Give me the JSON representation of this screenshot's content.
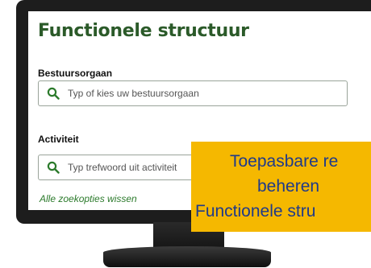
{
  "page": {
    "title": "Functionele structuur"
  },
  "bestuursorgaan": {
    "label": "Bestuursorgaan",
    "placeholder": "Typ of kies uw bestuursorgaan"
  },
  "activiteit": {
    "label": "Activiteit",
    "placeholder": "Typ trefwoord uit activiteit"
  },
  "clear_link": "Alle zoekopties wissen",
  "callout": {
    "lines": [
      "Toepasbare re",
      "beheren",
      "Functionele stru"
    ]
  },
  "colors": {
    "title_green": "#2b5a29",
    "icon_green": "#2b7a2b",
    "callout_bg": "#f5b800",
    "callout_text": "#1f3a8a"
  },
  "icons": {
    "search": "search-icon"
  }
}
